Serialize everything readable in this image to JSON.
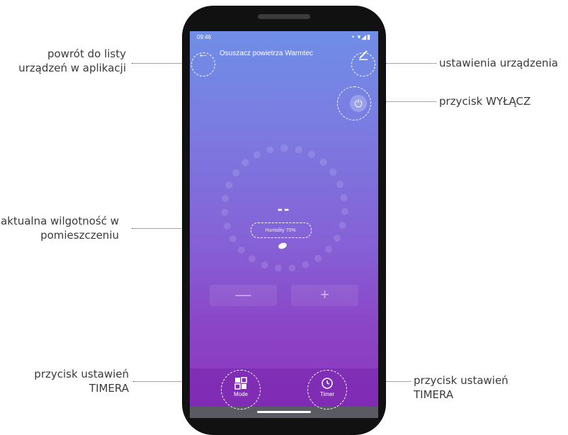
{
  "annotations": {
    "back": "powrót do listy urządzeń w aplikacji",
    "settings": "ustawienia urządzenia",
    "power": "przycisk WYŁĄCZ",
    "humidity": "aktualna wilgotność w pomieszczeniu",
    "mode": "przycisk ustawień TIMERA",
    "timer": "przycisk ustawień TIMERA"
  },
  "status_bar": {
    "time": "09:46",
    "dot": "•",
    "icons": "• ▾◢▮"
  },
  "app_bar": {
    "back_icon": "arrow-left-icon",
    "title": "Osuszacz powietrza Warmtec",
    "edit_icon": "pencil-icon"
  },
  "power_icon": "⏻",
  "humidity": {
    "value": "--",
    "label": "Humidity 70%"
  },
  "controls": {
    "minus": "—",
    "plus": "+"
  },
  "bottom": {
    "mode_label": "Mode",
    "timer_label": "Timer"
  }
}
